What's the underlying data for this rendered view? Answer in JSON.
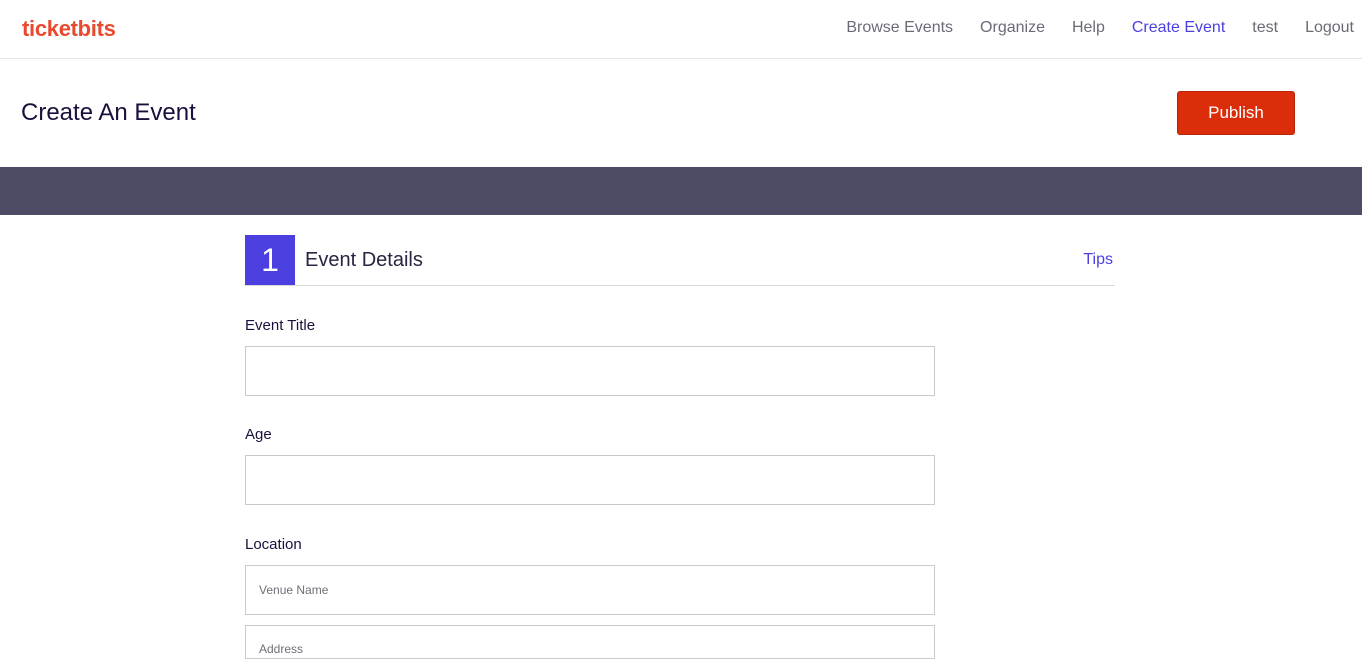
{
  "brand": {
    "logo": "ticketbits",
    "color": "#e8492f"
  },
  "nav": {
    "items": [
      {
        "label": "Browse Events",
        "active": false
      },
      {
        "label": "Organize",
        "active": false
      },
      {
        "label": "Help",
        "active": false
      },
      {
        "label": "Create Event",
        "active": true
      },
      {
        "label": "test",
        "active": false
      },
      {
        "label": "Logout",
        "active": false
      }
    ],
    "active_color": "#4b3fe0"
  },
  "header": {
    "title": "Create An Event",
    "publish_label": "Publish",
    "publish_color": "#dc2d0b"
  },
  "band_color": "#4d4b65",
  "section": {
    "step": "1",
    "title": "Event Details",
    "tips_label": "Tips"
  },
  "form": {
    "event_title": {
      "label": "Event Title",
      "value": "",
      "placeholder": ""
    },
    "age": {
      "label": "Age",
      "value": "",
      "placeholder": ""
    },
    "location": {
      "label": "Location",
      "venue_placeholder": "Venue Name",
      "address_placeholder": "Address"
    }
  }
}
